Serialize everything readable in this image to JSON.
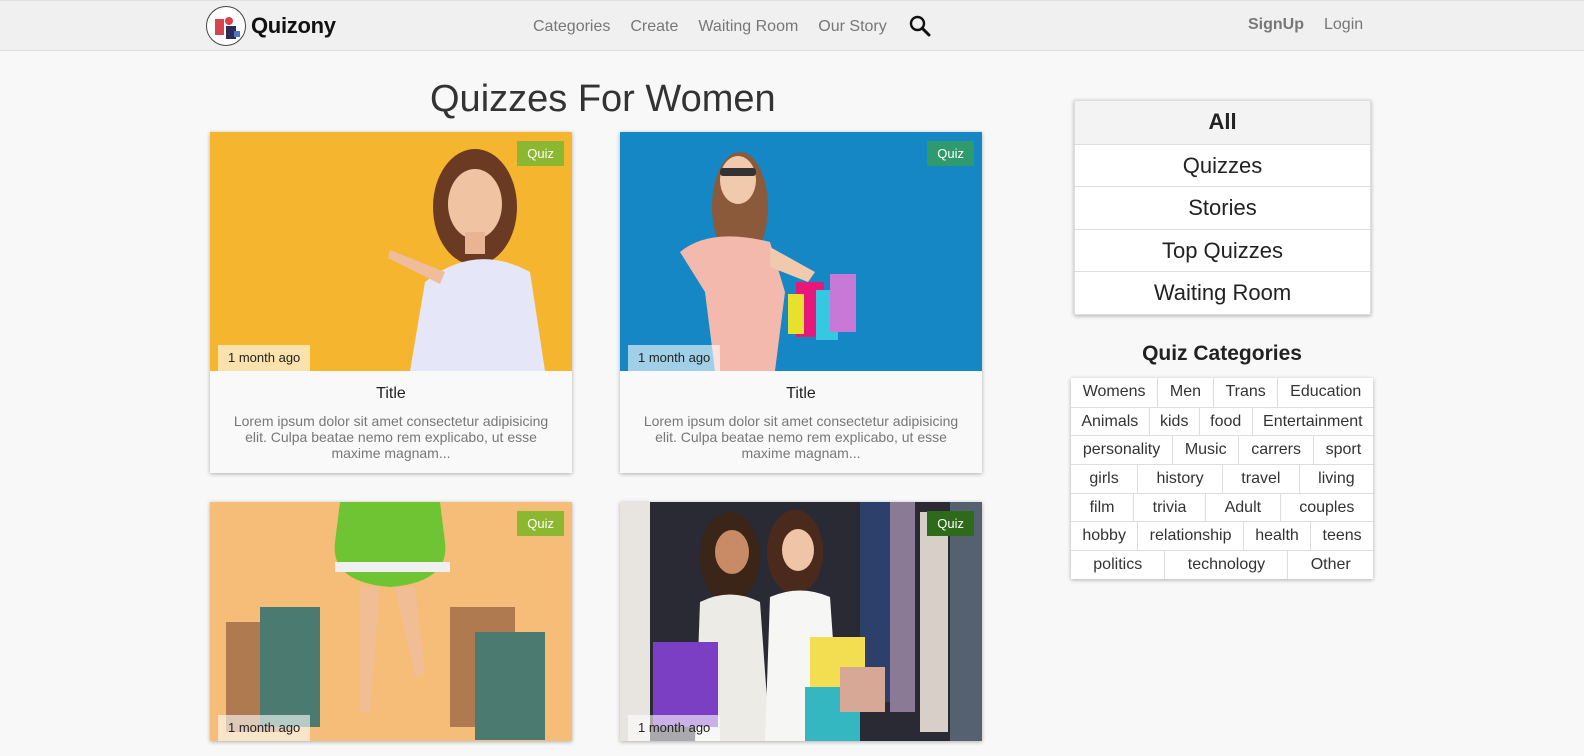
{
  "brand": {
    "name": "Quizony"
  },
  "nav": {
    "links": [
      "Categories",
      "Create",
      "Waiting Room",
      "Our Story"
    ],
    "signup": "SignUp",
    "login": "Login"
  },
  "page_title": "Quizzes For Women",
  "cards": [
    {
      "badge": "Quiz",
      "badge_color": "#8bb830",
      "time": "1 month ago",
      "title": "Title",
      "text": "Lorem ipsum dolor sit amet consectetur adipisicing elit. Culpa beatae nemo rem explicabo, ut esse maxime magnam..."
    },
    {
      "badge": "Quiz",
      "badge_color": "#2e9a6e",
      "time": "1 month ago",
      "title": "Title",
      "text": "Lorem ipsum dolor sit amet consectetur adipisicing elit. Culpa beatae nemo rem explicabo, ut esse maxime magnam..."
    },
    {
      "badge": "Quiz",
      "badge_color": "#8bb830",
      "time": "1 month ago"
    },
    {
      "badge": "Quiz",
      "badge_color": "#2d6b1a",
      "time": "1 month ago"
    }
  ],
  "filters": [
    "All",
    "Quizzes",
    "Stories",
    "Top Quizzes",
    "Waiting Room"
  ],
  "categories_title": "Quiz Categories",
  "categories": [
    [
      "Womens",
      "Men",
      "Trans",
      "Education"
    ],
    [
      "Animals",
      "kids",
      "food",
      "Entertainment"
    ],
    [
      "personality",
      "Music",
      "carrers",
      "sport"
    ],
    [
      "girls",
      "history",
      "travel",
      "living"
    ],
    [
      "film",
      "trivia",
      "Adult",
      "couples"
    ],
    [
      "hobby",
      "relationship",
      "health",
      "teens"
    ],
    [
      "politics",
      "technology",
      "Other"
    ]
  ],
  "icons": {
    "search": "search-icon",
    "logo": "logo-icon"
  }
}
